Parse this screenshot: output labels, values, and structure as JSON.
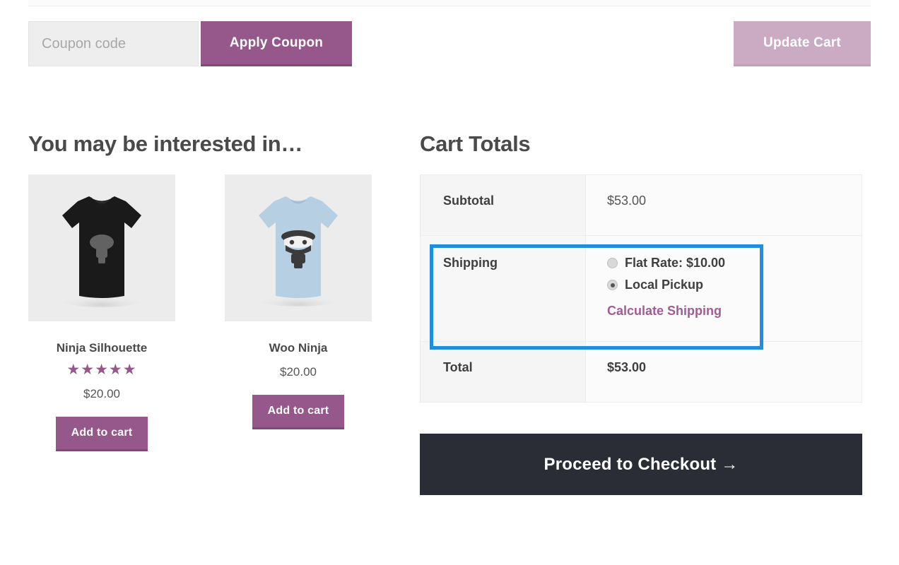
{
  "coupon": {
    "placeholder": "Coupon code",
    "value": "",
    "apply_label": "Apply Coupon",
    "update_cart_label": "Update Cart"
  },
  "upsells": {
    "title": "You may be interested in…",
    "products": [
      {
        "name": "Ninja Silhouette",
        "price": "$20.00",
        "rating": "★★★★★",
        "rating_value": 5,
        "has_rating": true,
        "add_to_cart_label": "Add to cart",
        "shirt_color": "#1a1a1a",
        "thumb_bg": "#ececec"
      },
      {
        "name": "Woo Ninja",
        "price": "$20.00",
        "rating": "",
        "rating_value": 0,
        "has_rating": false,
        "add_to_cart_label": "Add to cart",
        "shirt_color": "#b7cfe3",
        "thumb_bg": "#ececec"
      }
    ]
  },
  "cart_totals": {
    "title": "Cart Totals",
    "subtotal_label": "Subtotal",
    "subtotal_value": "$53.00",
    "shipping_label": "Shipping",
    "shipping_options": [
      {
        "label": "Flat Rate: $10.00",
        "selected": false
      },
      {
        "label": "Local Pickup",
        "selected": true
      }
    ],
    "calculate_shipping_label": "Calculate Shipping",
    "total_label": "Total",
    "total_value": "$53.00",
    "checkout_label": "Proceed to Checkout  →"
  },
  "colors": {
    "brand_purple": "#96588a",
    "purple_disabled": "#cbaac4",
    "highlight_blue": "#1e8fe0",
    "checkout_dark": "#2b2d36",
    "link_purple": "#a05c95"
  }
}
